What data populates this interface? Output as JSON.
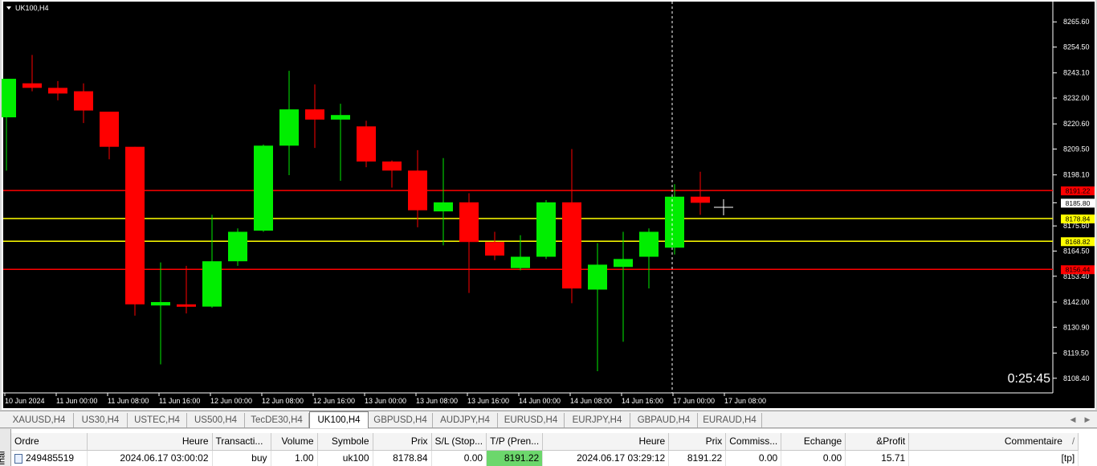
{
  "chart": {
    "symbol_label": "UK100,H4",
    "timer": "0:25:45",
    "colors": {
      "background": "#000000",
      "frame": "#ffffff",
      "bull": "#00ee00",
      "bear": "#ff0000",
      "support_red": "#ff0000",
      "entry_yellow": "#ffff00",
      "grid_text": "#ffffff"
    },
    "price_axis": {
      "min": 8103,
      "max": 8271,
      "ticks": [
        "8265.60",
        "8254.50",
        "8243.10",
        "8232.00",
        "8220.60",
        "8209.50",
        "8198.10",
        "8185.80",
        "8175.60",
        "8164.50",
        "8153.40",
        "8142.00",
        "8130.90",
        "8119.50",
        "8108.40"
      ]
    },
    "hlines": [
      {
        "price": 8191.22,
        "label": "8191.22",
        "color": "#ff0000"
      },
      {
        "price": 8178.84,
        "label": "8178.84",
        "color": "#ffff00"
      },
      {
        "price": 8168.82,
        "label": "8168.82",
        "color": "#ffff00"
      },
      {
        "price": 8156.44,
        "label": "8156.44",
        "color": "#ff0000"
      }
    ],
    "current_price": {
      "price": 8185.8,
      "label": "8185.80"
    },
    "time_labels": [
      "10 Jun 2024",
      "11 Jun 00:00",
      "11 Jun 08:00",
      "11 Jun 16:00",
      "12 Jun 00:00",
      "12 Jun 08:00",
      "12 Jun 16:00",
      "13 Jun 00:00",
      "13 Jun 08:00",
      "13 Jun 16:00",
      "14 Jun 00:00",
      "14 Jun 08:00",
      "14 Jun 16:00",
      "17 Jun 00:00",
      "17 Jun 08:00"
    ]
  },
  "chart_data": {
    "type": "candlestick",
    "candles": [
      {
        "o": 8223.5,
        "h": 8235,
        "l": 8200,
        "c": 8240.5
      },
      {
        "o": 8238.5,
        "h": 8251,
        "l": 8235,
        "c": 8236.5
      },
      {
        "o": 8236.5,
        "h": 8239.5,
        "l": 8231,
        "c": 8234
      },
      {
        "o": 8235,
        "h": 8238.5,
        "l": 8221,
        "c": 8226.5
      },
      {
        "o": 8226,
        "h": 8226,
        "l": 8205,
        "c": 8210.5
      },
      {
        "o": 8210.5,
        "h": 8210.5,
        "l": 8136,
        "c": 8141
      },
      {
        "o": 8140.5,
        "h": 8159.5,
        "l": 8114.5,
        "c": 8142
      },
      {
        "o": 8141,
        "h": 8158,
        "l": 8137,
        "c": 8140.5
      },
      {
        "o": 8140,
        "h": 8180.5,
        "l": 8139.5,
        "c": 8160
      },
      {
        "o": 8160,
        "h": 8174.5,
        "l": 8158,
        "c": 8173
      },
      {
        "o": 8173.5,
        "h": 8211.5,
        "l": 8173,
        "c": 8211
      },
      {
        "o": 8211,
        "h": 8244,
        "l": 8198,
        "c": 8227
      },
      {
        "o": 8227,
        "h": 8238,
        "l": 8210,
        "c": 8222.5
      },
      {
        "o": 8222.5,
        "h": 8229.5,
        "l": 8195.5,
        "c": 8224.5
      },
      {
        "o": 8219.5,
        "h": 8222,
        "l": 8201.5,
        "c": 8204
      },
      {
        "o": 8204,
        "h": 8204.5,
        "l": 8192.5,
        "c": 8200
      },
      {
        "o": 8200,
        "h": 8209,
        "l": 8175,
        "c": 8182.5
      },
      {
        "o": 8182,
        "h": 8205.5,
        "l": 8167,
        "c": 8186
      },
      {
        "o": 8186,
        "h": 8190,
        "l": 8146,
        "c": 8168.5
      },
      {
        "o": 8168.5,
        "h": 8173,
        "l": 8160.5,
        "c": 8162.5
      },
      {
        "o": 8157,
        "h": 8171.5,
        "l": 8156,
        "c": 8162
      },
      {
        "o": 8162,
        "h": 8187,
        "l": 8161,
        "c": 8186
      },
      {
        "o": 8186,
        "h": 8209.5,
        "l": 8141.5,
        "c": 8148
      },
      {
        "o": 8147.5,
        "h": 8168,
        "l": 8111.5,
        "c": 8158.5
      },
      {
        "o": 8157.5,
        "h": 8173,
        "l": 8124.5,
        "c": 8161
      },
      {
        "o": 8162,
        "h": 8174.5,
        "l": 8148,
        "c": 8173
      },
      {
        "o": 8166,
        "h": 8194,
        "l": 8163,
        "c": 8188.5
      },
      {
        "o": 8188.5,
        "h": 8199.5,
        "l": 8180.5,
        "c": 8185.8
      }
    ]
  },
  "tabs": {
    "items": [
      "XAUUSD,H4",
      "US30,H4",
      "USTEC,H4",
      "US500,H4",
      "TecDE30,H4",
      "UK100,H4",
      "GBPUSD,H4",
      "AUDJPY,H4",
      "EURUSD,H4",
      "EURJPY,H4",
      "GBPAUD,H4",
      "EURAUD,H4"
    ],
    "active_index": 5
  },
  "terminal": {
    "side_label": "inal",
    "columns": [
      "Ordre",
      "Heure",
      "Transacti...",
      "Volume",
      "Symbole",
      "Prix",
      "S/L (Stop...",
      "T/P (Pren...",
      "Heure",
      "Prix",
      "Commiss...",
      "Echange",
      "&Profit",
      "Commentaire"
    ],
    "row": {
      "ordre": "249485519",
      "heure_open": "2024.06.17 03:00:02",
      "transaction": "buy",
      "volume": "1.00",
      "symbole": "uk100",
      "prix_open": "8178.84",
      "sl": "0.00",
      "tp": "8191.22",
      "heure_close": "2024.06.17 03:29:12",
      "prix_close": "8191.22",
      "commission": "0.00",
      "echange": "0.00",
      "profit": "15.71",
      "commentaire": "[tp]"
    }
  }
}
